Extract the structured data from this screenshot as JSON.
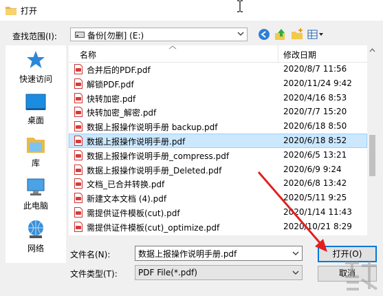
{
  "window": {
    "title": "打开"
  },
  "toolbar": {
    "look_in_label": "查找范围(I):",
    "look_in_value": "备份[勿删] (E:)",
    "buttons": [
      {
        "name": "back-button",
        "icon": "back-arrow-icon"
      },
      {
        "name": "up-folder-button",
        "icon": "up-folder-icon"
      },
      {
        "name": "new-folder-button",
        "icon": "new-folder-icon"
      },
      {
        "name": "view-menu-button",
        "icon": "view-grid-icon"
      }
    ]
  },
  "sidebar": {
    "items": [
      {
        "label": "快速访问",
        "icon": "star-icon"
      },
      {
        "label": "桌面",
        "icon": "desktop-icon"
      },
      {
        "label": "库",
        "icon": "library-icon"
      },
      {
        "label": "此电脑",
        "icon": "computer-icon"
      },
      {
        "label": "网络",
        "icon": "network-icon"
      }
    ]
  },
  "filelist": {
    "col_name": "名称",
    "col_date": "修改日期",
    "files": [
      {
        "name": "合并后的PDF.pdf",
        "date": "2020/8/7 11:56"
      },
      {
        "name": "解锁PDF.pdf",
        "date": "2020/11/24 9:42"
      },
      {
        "name": "快转加密.pdf",
        "date": "2020/4/16 8:53"
      },
      {
        "name": "快转加密_解密.pdf",
        "date": "2020/7/7 15:20"
      },
      {
        "name": "数据上报操作说明手册 backup.pdf",
        "date": "2020/6/18 8:50"
      },
      {
        "name": "数据上报操作说明手册.pdf",
        "date": "2020/6/18 8:52",
        "selected": true
      },
      {
        "name": "数据上报操作说明手册_compress.pdf",
        "date": "2020/6/5 13:21"
      },
      {
        "name": "数据上报操作说明手册_Deleted.pdf",
        "date": "2020/6/9 9:24"
      },
      {
        "name": "文档_已合并转换.pdf",
        "date": "2020/6/8 13:42"
      },
      {
        "name": "新建文本文档 (4).pdf",
        "date": "2020/5/11 9:25"
      },
      {
        "name": "需提供证件模板(cut).pdf",
        "date": "2020/1/14 11:43"
      },
      {
        "name": "需提供证件模板(cut)_optimize.pdf",
        "date": "2020/10/21 8:29"
      }
    ]
  },
  "bottom": {
    "filename_label": "文件名(N):",
    "filename_value": "数据上报操作说明手册.pdf",
    "filetype_label": "文件类型(T):",
    "filetype_value": "PDF File(*.pdf)",
    "open_label": "打开(O)",
    "cancel_label": "取消"
  },
  "colors": {
    "selection": "#cce8ff",
    "accent": "#0078d7",
    "pdf_red": "#d63b3b",
    "annotation_arrow": "#e02020"
  }
}
